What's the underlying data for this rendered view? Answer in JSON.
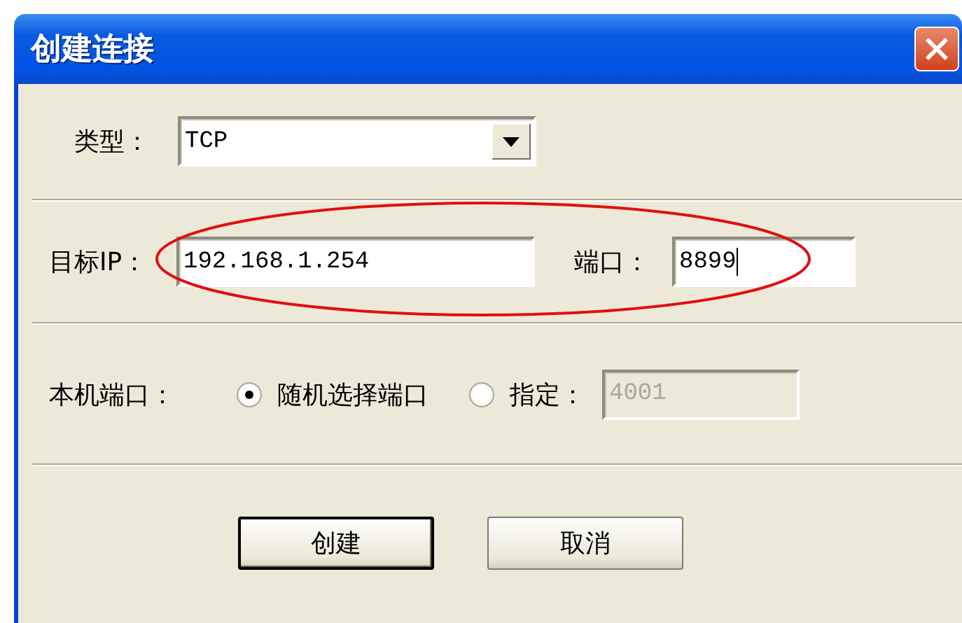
{
  "window": {
    "title": "创建连接"
  },
  "type_row": {
    "label": "类型：",
    "value": "TCP"
  },
  "target_row": {
    "ip_label": "目标IP：",
    "ip_value": "192.168.1.254",
    "port_label": "端口：",
    "port_value": "8899",
    "port_focused": true
  },
  "local_port": {
    "label": "本机端口：",
    "options": [
      {
        "label": "随机选择端口",
        "selected": true
      },
      {
        "label": "指定：",
        "selected": false
      }
    ],
    "custom_value": "4001",
    "custom_disabled": true
  },
  "buttons": [
    {
      "label": "创建",
      "default": true
    },
    {
      "label": "取消",
      "default": false
    }
  ]
}
